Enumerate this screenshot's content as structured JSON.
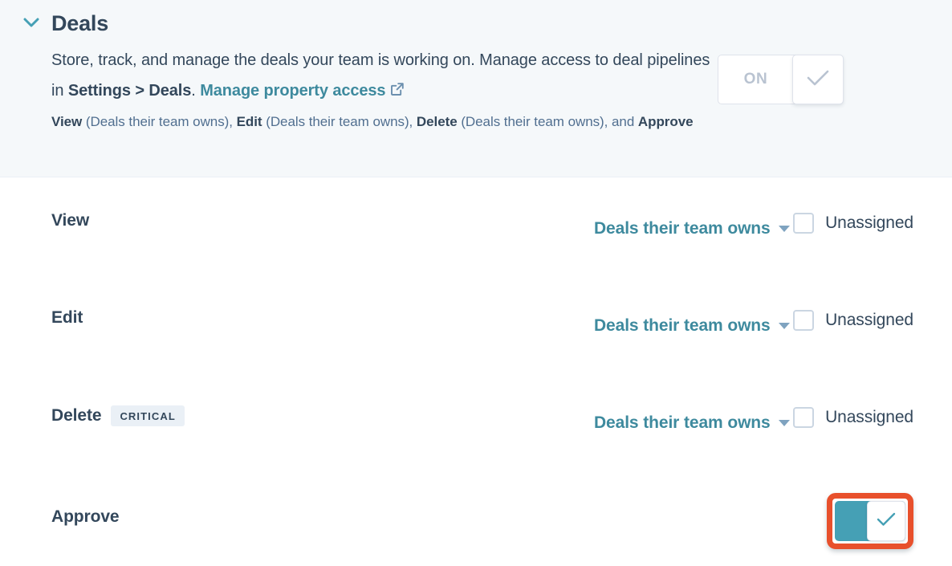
{
  "header": {
    "collapse_icon": "chevron-down-icon",
    "title": "Deals",
    "description_part1": "Store, track, and manage the deals your team is working on. Manage access to deal pipelines in ",
    "description_bold": "Settings > Deals",
    "description_part2": ". ",
    "link_label": "Manage property access",
    "link_icon": "external-link-icon",
    "summary": {
      "view_label": "View",
      "view_value": " (Deals their team owns), ",
      "edit_label": "Edit",
      "edit_value": " (Deals their team owns), ",
      "delete_label": "Delete",
      "delete_value": " (Deals their team owns), and ",
      "approve_label": "Approve"
    },
    "master_toggle": {
      "label": "ON",
      "state": "on",
      "disabled": true,
      "knob_icon": "check-icon"
    }
  },
  "rows": [
    {
      "label": "View",
      "badge": null,
      "access_value": "Deals their team owns",
      "dropdown_icon": "caret-down-icon",
      "unassigned_label": "Unassigned",
      "unassigned_checked": false
    },
    {
      "label": "Edit",
      "badge": null,
      "access_value": "Deals their team owns",
      "dropdown_icon": "caret-down-icon",
      "unassigned_label": "Unassigned",
      "unassigned_checked": false
    },
    {
      "label": "Delete",
      "badge": "CRITICAL",
      "access_value": "Deals their team owns",
      "dropdown_icon": "caret-down-icon",
      "unassigned_label": "Unassigned",
      "unassigned_checked": false
    },
    {
      "label": "Approve",
      "badge": null,
      "toggle": {
        "state": "on",
        "knob_icon": "check-icon",
        "highlighted": true
      }
    }
  ],
  "colors": {
    "accent_teal": "#3e8a9e",
    "toggle_on": "#45a0b5",
    "highlight_orange": "#e8502c",
    "text_dark": "#33475b",
    "text_muted": "#516f90",
    "header_bg": "#f5f8fa",
    "badge_bg": "#eaf0f6",
    "border": "#dfe3eb"
  }
}
